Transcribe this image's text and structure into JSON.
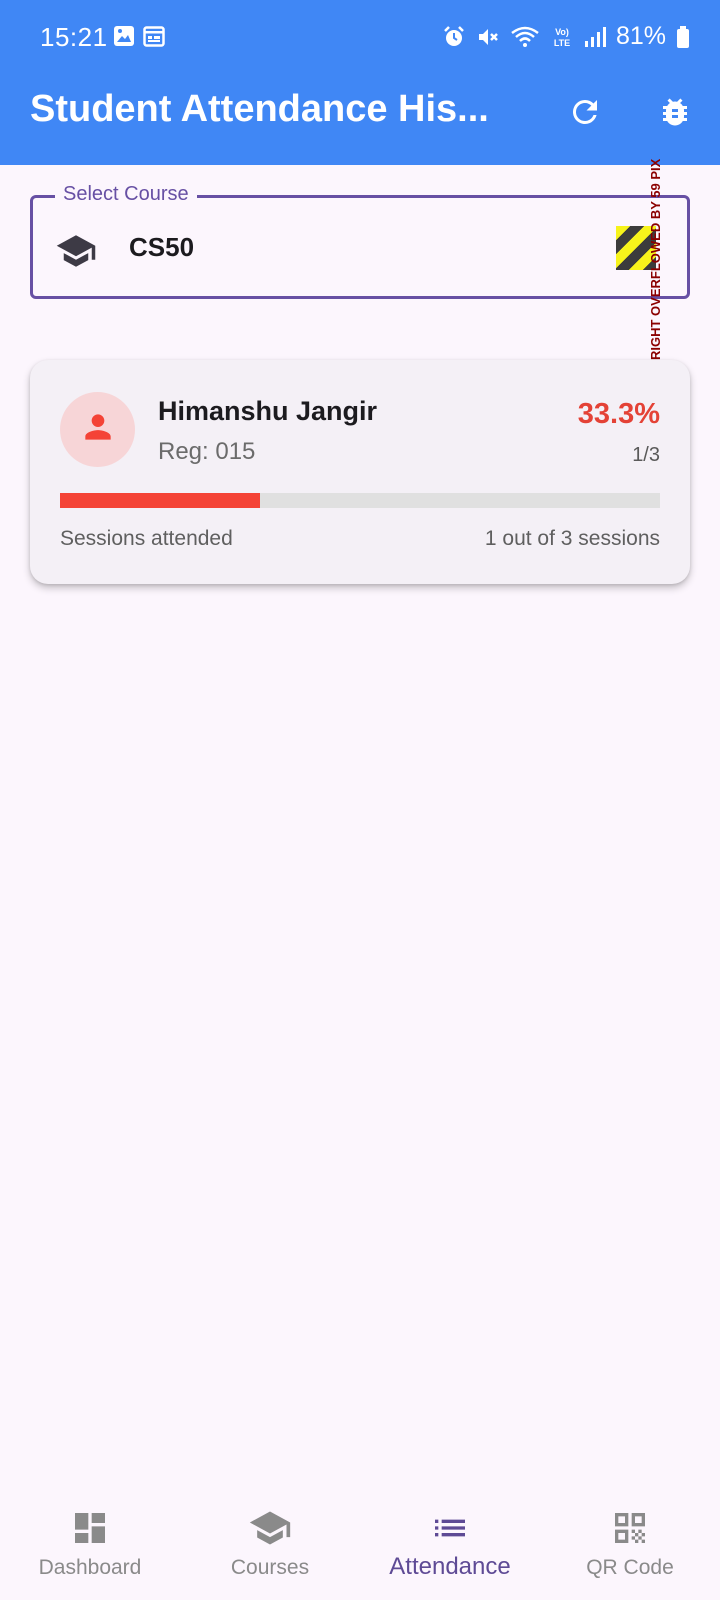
{
  "status_bar": {
    "time": "15:21",
    "battery": "81%",
    "left_icons": [
      "image-icon",
      "calendar-icon"
    ],
    "right_icons": [
      "alarm-icon",
      "mute-icon",
      "wifi-icon",
      "volte-icon",
      "signal-icon",
      "battery-icon"
    ]
  },
  "appbar": {
    "title": "Student Attendance His...",
    "actions": [
      "refresh-icon",
      "bug-icon"
    ],
    "color": "#4087f5"
  },
  "course_select": {
    "label": "Select Course",
    "value": "CS50",
    "icon": "graduation-cap-icon",
    "overflow_warning": "RIGHT OVERFLOWED BY 59 PIX"
  },
  "students": [
    {
      "name": "Himanshu Jangir",
      "reg": "Reg: 015",
      "percentage": "33.3%",
      "ratio": "1/3",
      "progress_fraction": 0.333,
      "sessions_label": "Sessions attended",
      "sessions_count": "1 out of 3 sessions",
      "accent": "#f44336"
    }
  ],
  "bottom_nav": {
    "items": [
      {
        "label": "Dashboard",
        "icon": "dashboard-icon",
        "active": false
      },
      {
        "label": "Courses",
        "icon": "graduation-cap-icon",
        "active": false
      },
      {
        "label": "Attendance",
        "icon": "list-icon",
        "active": true
      },
      {
        "label": "QR Code",
        "icon": "qr-code-icon",
        "active": false
      }
    ],
    "active_color": "#5e4a95"
  }
}
